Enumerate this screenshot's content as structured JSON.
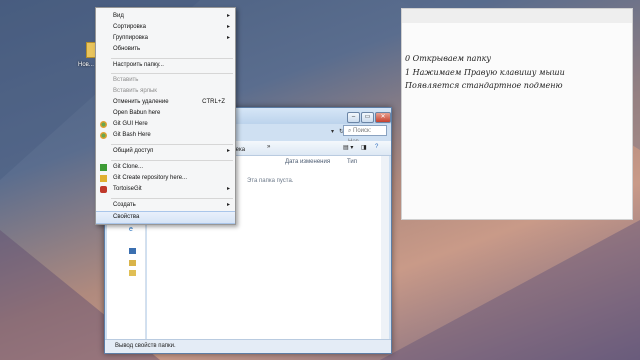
{
  "desktop": {
    "folder_label": "Нов..."
  },
  "context_menu": {
    "items": [
      {
        "label": "Вид",
        "submenu": true
      },
      {
        "label": "Сортировка",
        "submenu": true
      },
      {
        "label": "Группировка",
        "submenu": true
      },
      {
        "label": "Обновить"
      },
      {
        "label": "Настроить папку..."
      },
      {
        "label": "Вставить",
        "disabled": true
      },
      {
        "label": "Вставить ярлык",
        "disabled": true
      },
      {
        "label": "Отменить удаление",
        "shortcut": "CTRL+Z"
      },
      {
        "label": "Open Babun here"
      },
      {
        "label": "Git GUI Here",
        "icon": "git-gui-icon"
      },
      {
        "label": "Git Bash Here",
        "icon": "git-bash-icon"
      },
      {
        "label": "Общий доступ",
        "submenu": true
      },
      {
        "label": "Git Clone...",
        "icon": "git-clone-icon"
      },
      {
        "label": "Git Create repository here...",
        "icon": "tortoise-create-icon"
      },
      {
        "label": "TortoiseGit",
        "icon": "tortoisegit-icon",
        "submenu": true
      },
      {
        "label": "Создать",
        "submenu": true
      },
      {
        "label": "Свойства",
        "highlighted": true
      }
    ]
  },
  "explorer": {
    "search_placeholder": "Поиск: Нов...",
    "toolbar_partial": "тека",
    "toolbar_more": "»",
    "columns": {
      "date": "Дата изменения",
      "type": "Тип"
    },
    "empty_text": "Эта папка пуста.",
    "status_text": "Вывод свойств папки."
  },
  "notes": {
    "lines": [
      "0 Открываем папку",
      "1 Нажимаем Правую клавишу мыши",
      "Появляется стандартное подменю"
    ]
  },
  "colors": {
    "git_red": "#c0392b",
    "git_green": "#6aa84f",
    "tortoise_green": "#3d9b35",
    "highlight": "#d6e4f6"
  }
}
